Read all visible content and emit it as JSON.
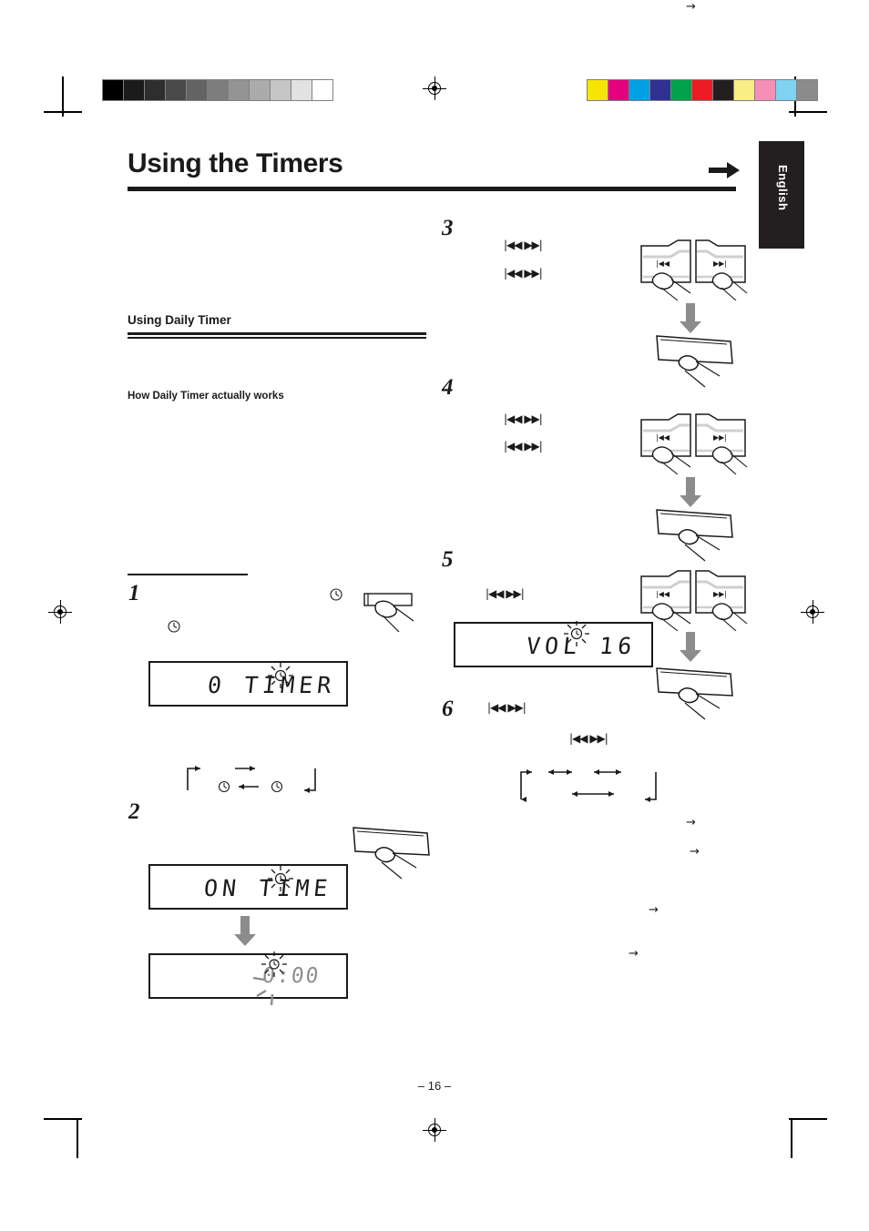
{
  "page": {
    "title": "Using the Timers",
    "language_tab": "English",
    "page_number": "– 16 –",
    "section_heading": "Using Daily Timer",
    "sub_heading": "How Daily Timer actually works"
  },
  "marks": {
    "grayscale_bar": [
      "#000000",
      "#1b1b1b",
      "#2e2e2e",
      "#4a4a4a",
      "#636363",
      "#7d7d7d",
      "#949494",
      "#ababab",
      "#c6c6c6",
      "#e2e2e2",
      "#ffffff"
    ],
    "color_bar": [
      "#f6e500",
      "#e5007d",
      "#00a0e4",
      "#2e3192",
      "#00a14b",
      "#ed1c24",
      "#231f20",
      "#f9ed86",
      "#f68fb8",
      "#7ed3f0",
      "#8c8c8c"
    ]
  },
  "steps": [
    {
      "number": "1",
      "display": "0 TIMER",
      "button_hint": "clock-button"
    },
    {
      "number": "2",
      "display": "ON TIME",
      "display_2": "0:00",
      "button_hint": "set-button"
    },
    {
      "number": "3",
      "transport_top": "|◀◀   ▶▶|",
      "transport_bottom": "|◀◀   ▶▶|"
    },
    {
      "number": "4",
      "transport_top": "|◀◀   ▶▶|",
      "transport_bottom": "|◀◀   ▶▶|"
    },
    {
      "number": "5",
      "transport_top": "|◀◀   ▶▶|",
      "display": "VOL 16"
    },
    {
      "number": "6",
      "transport_top": "|◀◀   ▶▶|",
      "transport_bottom": "|◀◀   ▶▶|"
    }
  ],
  "displays": {
    "timer": "0 TIMER",
    "on_time": "ON TIME",
    "time_value": "0:00",
    "volume": "VOL 16"
  },
  "transport_labels": {
    "rewind": "|◀◀",
    "forward": "▶▶|",
    "pair": "|◀◀   ▶▶|"
  },
  "arrows": {
    "right": "→",
    "left": "←",
    "bi": "←→"
  }
}
